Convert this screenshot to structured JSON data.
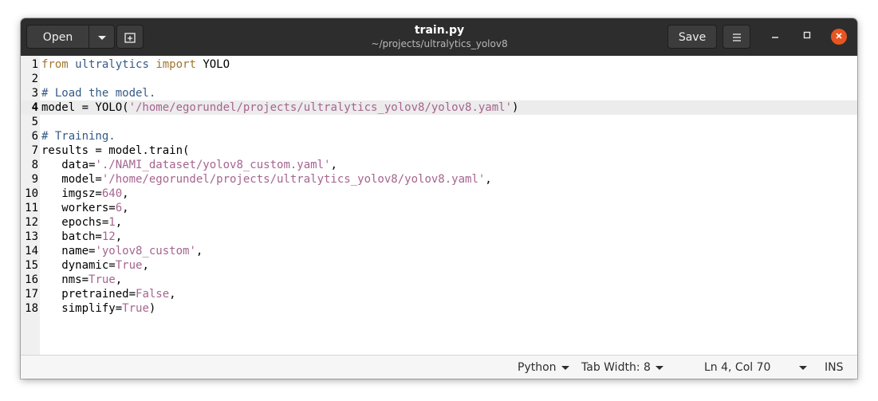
{
  "header": {
    "open_label": "Open",
    "title": "train.py",
    "subtitle": "~/projects/ultralytics_yolov8",
    "save_label": "Save"
  },
  "icons": {
    "open_dropdown": "chevron-down-icon",
    "new_tab": "new-tab-icon",
    "menu": "hamburger-menu-icon",
    "minimize": "minimize-icon",
    "maximize": "maximize-icon",
    "close": "close-icon"
  },
  "colors": {
    "close_button": "#e95420",
    "keyword": "#a0752f",
    "module": "#355a87",
    "string": "#a5648f",
    "comment": "#355a87"
  },
  "editor": {
    "current_line": 4,
    "lines": [
      [
        {
          "t": "from",
          "c": "kw"
        },
        {
          "t": " "
        },
        {
          "t": "ultralytics",
          "c": "mod"
        },
        {
          "t": " "
        },
        {
          "t": "import",
          "c": "kw"
        },
        {
          "t": " YOLO"
        }
      ],
      [],
      [
        {
          "t": "# Load the model.",
          "c": "cmt"
        }
      ],
      [
        {
          "t": "model = YOLO("
        },
        {
          "t": "'/home/egorundel/projects/ultralytics_yolov8/yolov8.yaml'",
          "c": "str"
        },
        {
          "t": ")"
        }
      ],
      [],
      [
        {
          "t": "# Training.",
          "c": "cmt"
        }
      ],
      [
        {
          "t": "results = model.train("
        }
      ],
      [
        {
          "t": "   data="
        },
        {
          "t": "'./NAMI_dataset/yolov8_custom.yaml'",
          "c": "str"
        },
        {
          "t": ","
        }
      ],
      [
        {
          "t": "   model="
        },
        {
          "t": "'/home/egorundel/projects/ultralytics_yolov8/yolov8.yaml'",
          "c": "str"
        },
        {
          "t": ","
        }
      ],
      [
        {
          "t": "   imgsz="
        },
        {
          "t": "640",
          "c": "num"
        },
        {
          "t": ","
        }
      ],
      [
        {
          "t": "   workers="
        },
        {
          "t": "6",
          "c": "num"
        },
        {
          "t": ","
        }
      ],
      [
        {
          "t": "   epochs="
        },
        {
          "t": "1",
          "c": "num"
        },
        {
          "t": ","
        }
      ],
      [
        {
          "t": "   batch="
        },
        {
          "t": "12",
          "c": "num"
        },
        {
          "t": ","
        }
      ],
      [
        {
          "t": "   name="
        },
        {
          "t": "'yolov8_custom'",
          "c": "str"
        },
        {
          "t": ","
        }
      ],
      [
        {
          "t": "   dynamic="
        },
        {
          "t": "True",
          "c": "const"
        },
        {
          "t": ","
        }
      ],
      [
        {
          "t": "   nms="
        },
        {
          "t": "True",
          "c": "const"
        },
        {
          "t": ","
        }
      ],
      [
        {
          "t": "   pretrained="
        },
        {
          "t": "False",
          "c": "const"
        },
        {
          "t": ","
        }
      ],
      [
        {
          "t": "   simplify="
        },
        {
          "t": "True",
          "c": "const"
        },
        {
          "t": ")"
        }
      ]
    ]
  },
  "statusbar": {
    "language": "Python",
    "tab_width": "Tab Width: 8",
    "position": "Ln 4, Col 70",
    "mode": "INS"
  }
}
